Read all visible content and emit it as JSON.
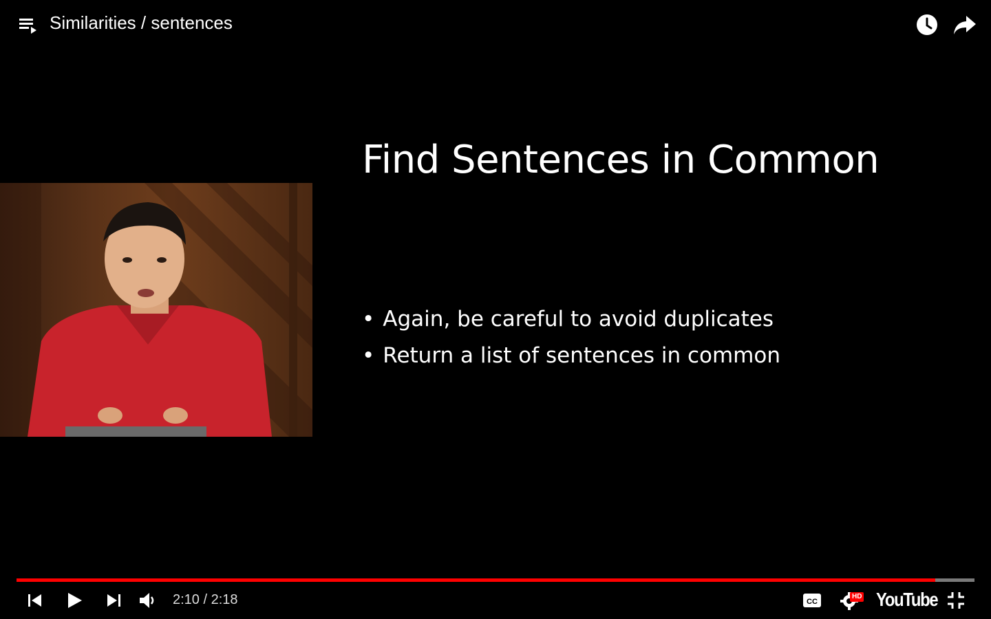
{
  "player": {
    "title": "Similarities / sentences",
    "time_display": "2:10 / 2:18",
    "progress_fraction": 0.9594,
    "logo_text": "YouTube",
    "hd_badge": "HD"
  },
  "slide": {
    "title": "Find Sentences in Common",
    "bullets": [
      "Again, be careful to avoid duplicates",
      "Return a list of sentences in common"
    ]
  },
  "colors": {
    "progress": "#ff0000",
    "background": "#000000"
  },
  "icons": [
    "playlist-icon",
    "watch-later-icon",
    "share-icon",
    "previous-icon",
    "play-icon",
    "next-icon",
    "volume-icon",
    "captions-icon",
    "settings-icon",
    "exit-fullscreen-icon"
  ]
}
